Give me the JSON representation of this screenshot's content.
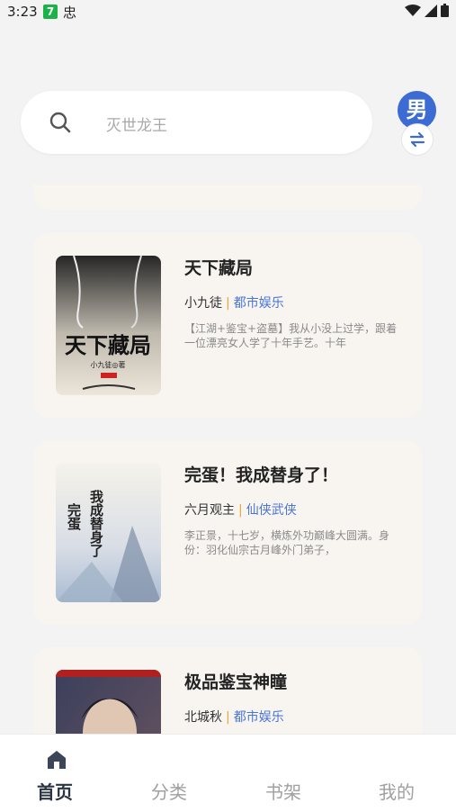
{
  "status_bar": {
    "time": "3:23",
    "badge": "7",
    "app_glyph": "忠"
  },
  "search": {
    "placeholder": "灭世龙王"
  },
  "gender_toggle": {
    "label": "男"
  },
  "books": [
    {
      "title": "天下藏局",
      "author": "小九徒",
      "genre": "都市娱乐",
      "desc": "【江湖+鉴宝+盗墓】我从小没上过学，跟着一位漂亮女人学了十年手艺。十年",
      "cover_text": "天下藏局",
      "cover_author": "小九徒◎著"
    },
    {
      "title": "完蛋！我成替身了！",
      "author": "六月观主",
      "genre": "仙侠武侠",
      "desc": "李正景，十七岁，横炼外功巅峰大圆满。身份：羽化仙宗古月峰外门弟子，",
      "cover_text": "我成替身了",
      "cover_text2": "完蛋"
    },
    {
      "title": "极品鉴宝神瞳",
      "author": "北城秋",
      "genre": "都市娱乐"
    }
  ],
  "nav": {
    "home": "首页",
    "category": "分类",
    "bookshelf": "书架",
    "mine": "我的"
  },
  "colors": {
    "accent": "#3c6bd4",
    "card_bg": "#f8f5f1",
    "genre": "#4a74d6",
    "separator": "#e8a53b"
  }
}
